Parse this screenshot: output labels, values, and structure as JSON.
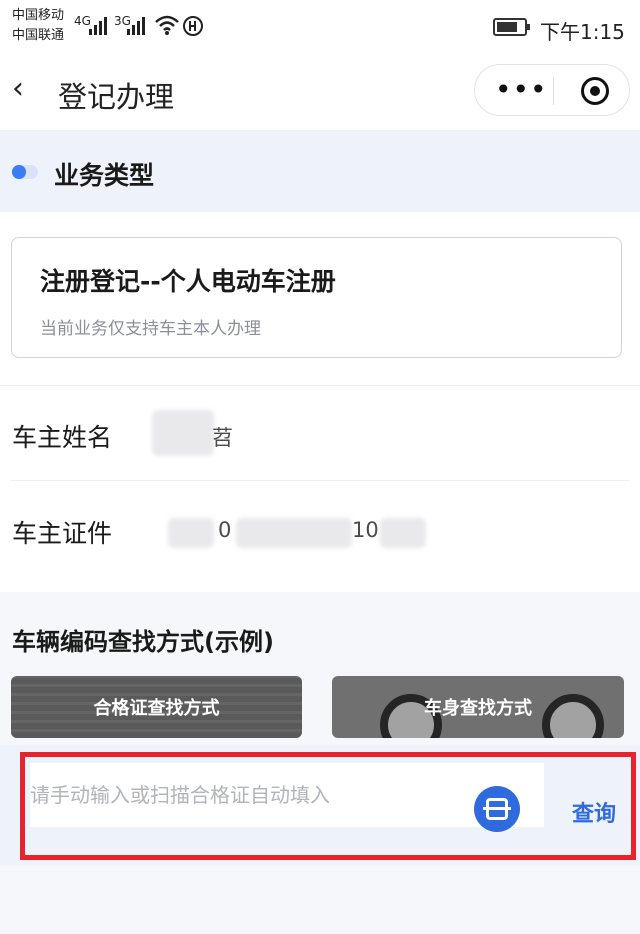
{
  "status_bar": {
    "carrier_1": "中国移动",
    "carrier_2": "中国联通",
    "network_1": "4G",
    "network_2": "3G",
    "time": "下午1:15",
    "icons": [
      "signal-icon",
      "wifi-icon",
      "battery-icon"
    ]
  },
  "navbar": {
    "back_icon": "‹",
    "title": "登记办理",
    "more_icon": "•••"
  },
  "business": {
    "section_title": "业务类型",
    "type_title": "注册登记--个人电动车注册",
    "type_note": "当前业务仅支持车主本人办理"
  },
  "owner": {
    "name_label": "车主姓名",
    "name_value": "苕",
    "id_label": "车主证件",
    "id_value_1": "0",
    "id_value_2": "10"
  },
  "lookup": {
    "title": "车辆编码查找方式(示例)",
    "cert_label": "合格证查找方式",
    "body_label": "车身查找方式"
  },
  "search": {
    "placeholder": "请手动输入或扫描合格证自动填入",
    "value": "",
    "query_label": "查询"
  },
  "colors": {
    "accent": "#2f6bdc",
    "highlight": "#e8232d"
  }
}
